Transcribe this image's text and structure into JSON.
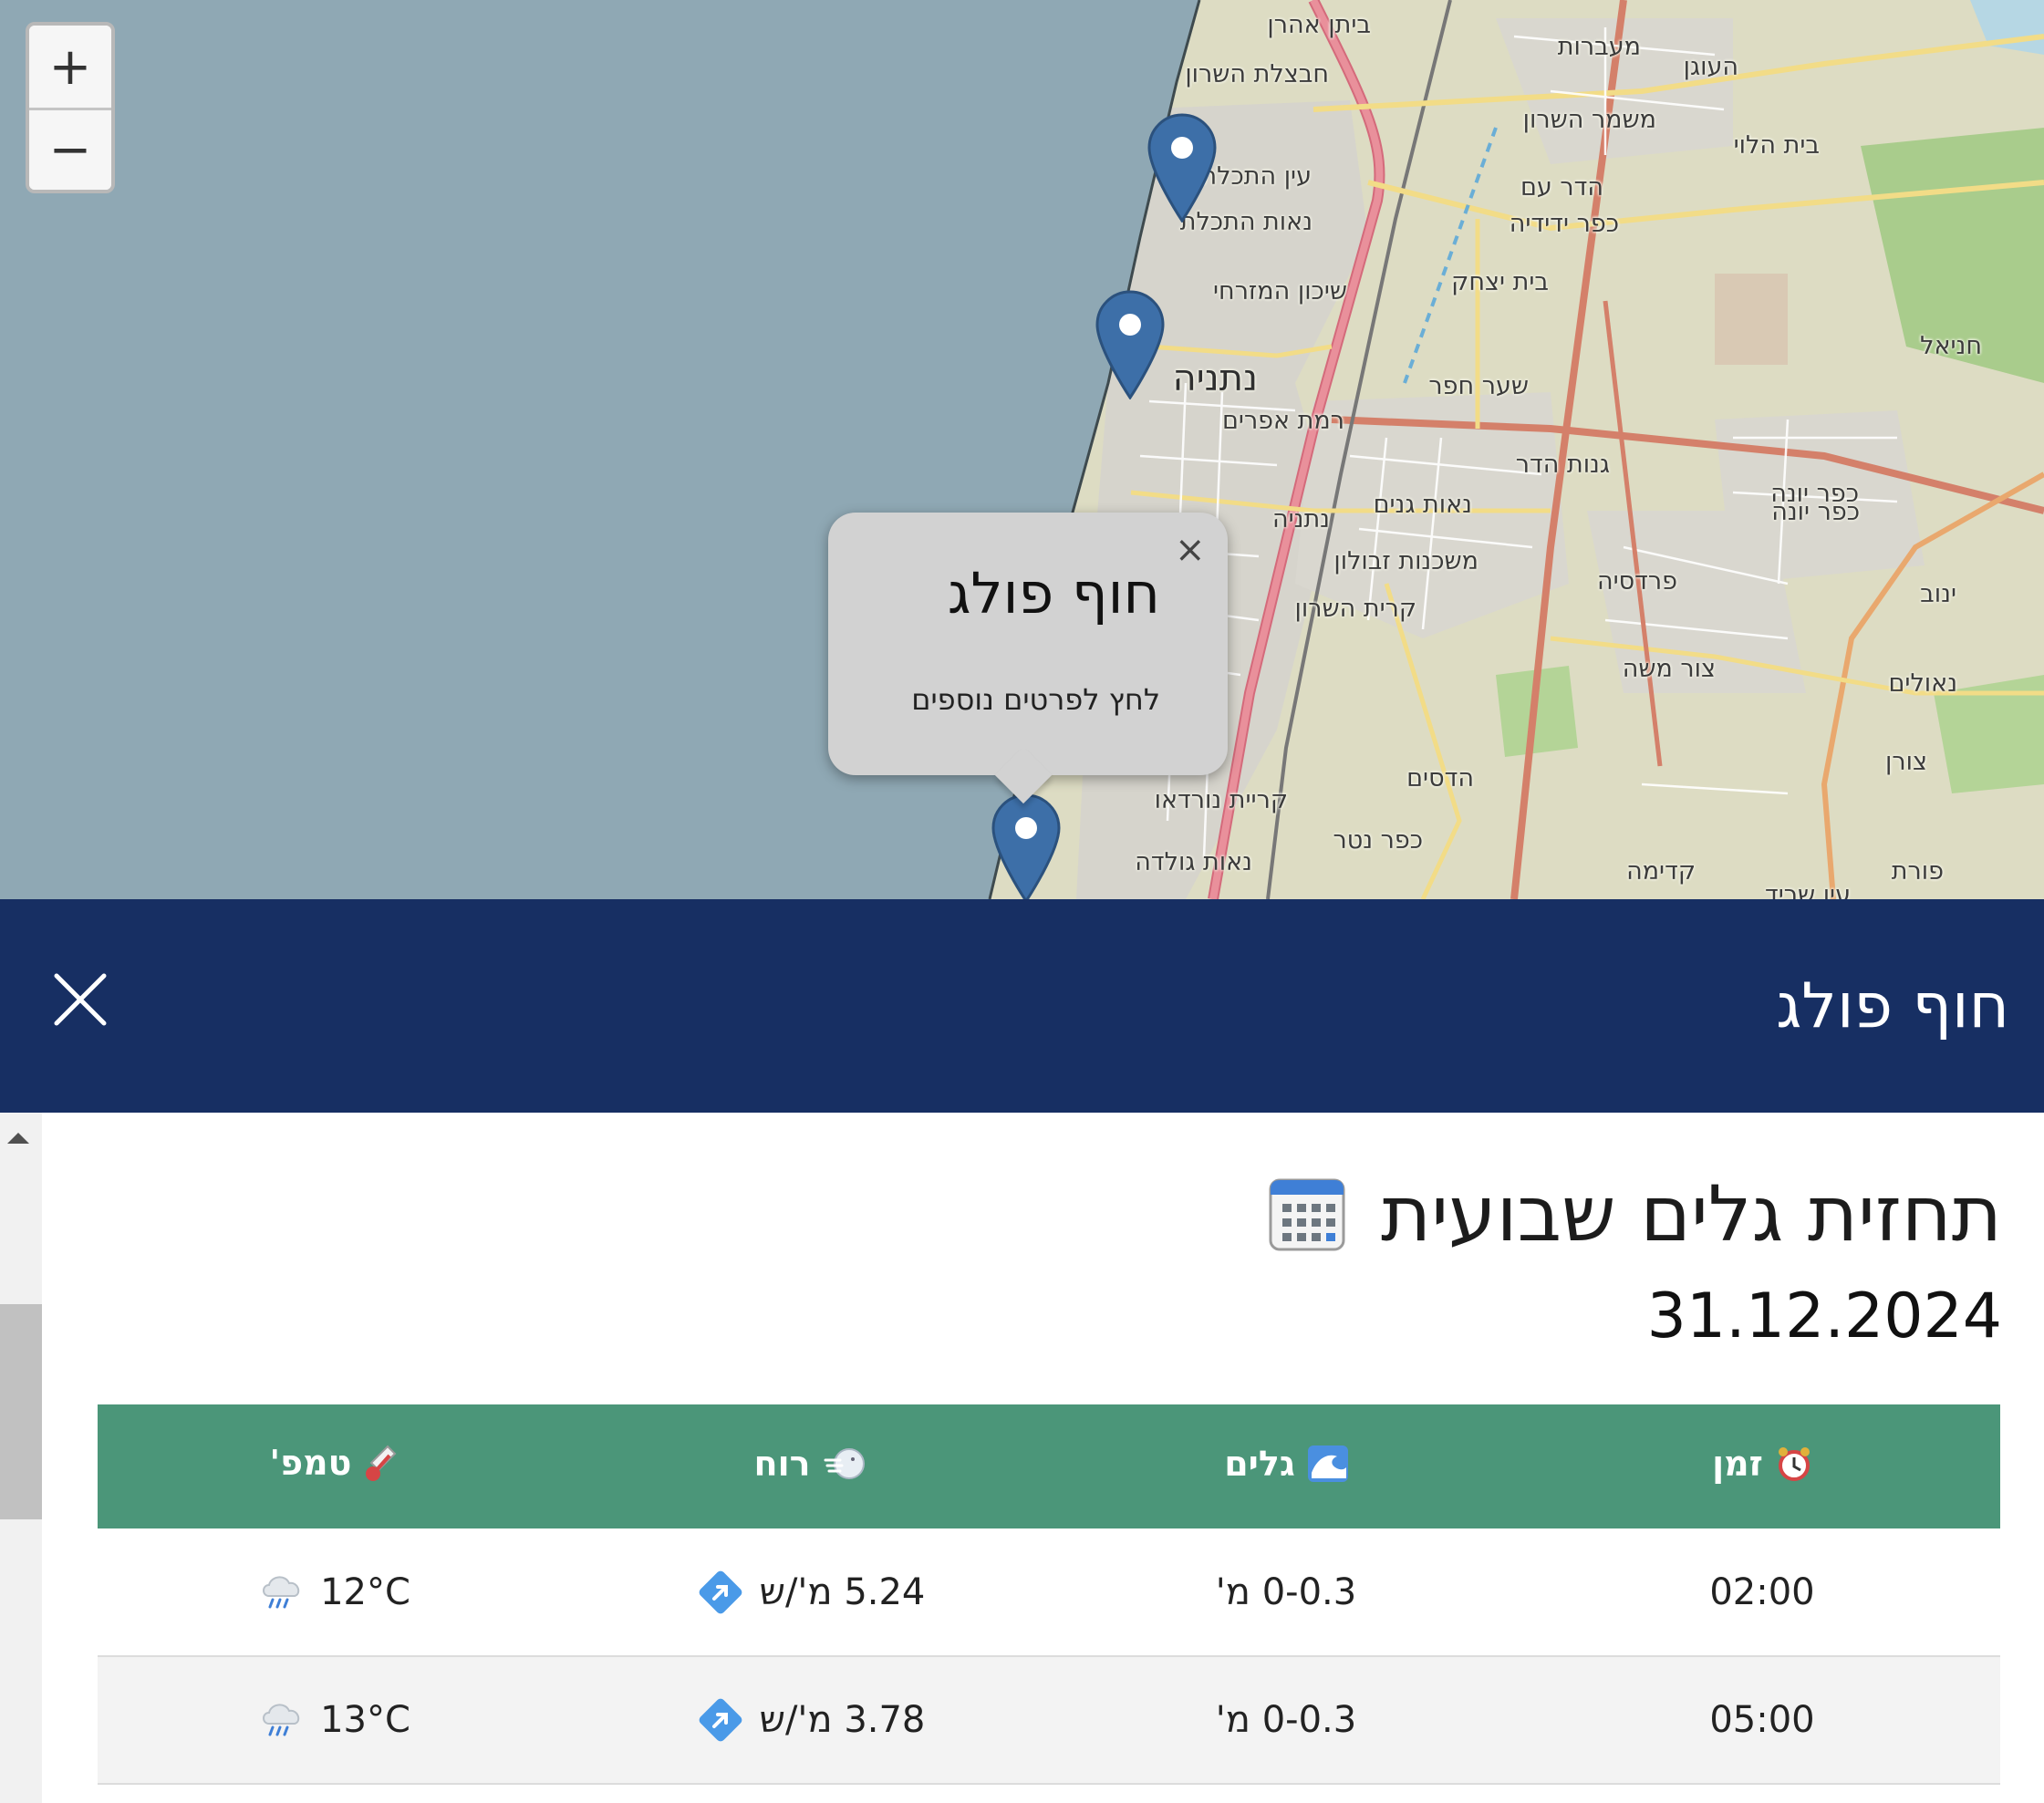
{
  "map": {
    "zoom_in_label": "+",
    "zoom_out_label": "−",
    "places": [
      {
        "name": "ביתן אהרן"
      },
      {
        "name": "מעברות"
      },
      {
        "name": "העוגן"
      },
      {
        "name": "חבצלת השרון"
      },
      {
        "name": "משמר השרון"
      },
      {
        "name": "בית הלוי"
      },
      {
        "name": "עין התכלת"
      },
      {
        "name": "הדר עם"
      },
      {
        "name": "נאות התכלת"
      },
      {
        "name": "כפר ידידיה"
      },
      {
        "name": "בית יצחק"
      },
      {
        "name": "שיכון המזרחי"
      },
      {
        "name": "חניאל"
      },
      {
        "name": "נתניה"
      },
      {
        "name": "שער חפר"
      },
      {
        "name": "רמת אפרים"
      },
      {
        "name": "גנות הדר"
      },
      {
        "name": "נאות גנים"
      },
      {
        "name": "כפר יונה"
      },
      {
        "name": "כפר יונה"
      },
      {
        "name": "נתניה"
      },
      {
        "name": "משכנות זבולון"
      },
      {
        "name": "פרדסיה"
      },
      {
        "name": "ינוב"
      },
      {
        "name": "קרית השרון"
      },
      {
        "name": "צור משה"
      },
      {
        "name": "נאולים"
      },
      {
        "name": "צורן"
      },
      {
        "name": "הדסים"
      },
      {
        "name": "קריית נורדאו"
      },
      {
        "name": "כפר נטר"
      },
      {
        "name": "נאות גולדה"
      },
      {
        "name": "קדימה"
      },
      {
        "name": "פורת"
      },
      {
        "name": "עין שריד"
      }
    ],
    "popup": {
      "close_label": "×",
      "title": "חוף פולג",
      "link": "לחץ לפרטים נוספים"
    }
  },
  "panel": {
    "title": "חוף פולג"
  },
  "content": {
    "section_title": "תחזית גלים שבועית",
    "date": "31.12.2024",
    "table": {
      "headers": {
        "time": "זמן",
        "waves": "גלים",
        "wind": "רוח",
        "temp": "טמפ'"
      },
      "rows": [
        {
          "time": "02:00",
          "waves": "0-0.3 מ'",
          "wind": "5.24 מ'/ש",
          "temp": "12°C"
        },
        {
          "time": "05:00",
          "waves": "0-0.3 מ'",
          "wind": "3.78 מ'/ש",
          "temp": "13°C"
        }
      ]
    }
  },
  "colors": {
    "header_bg": "#172f63",
    "table_header_bg": "#4b9679",
    "sea": "#8fa8b4",
    "pin": "#3d6fa8"
  }
}
